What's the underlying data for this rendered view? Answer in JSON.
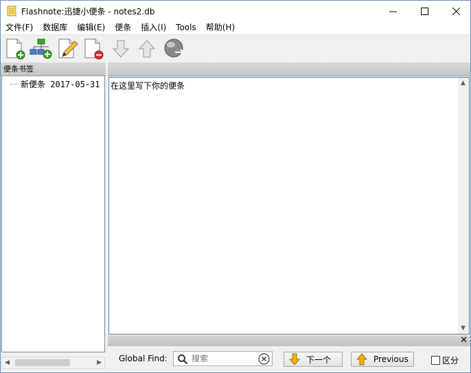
{
  "window": {
    "title": "Flashnote:迅捷小便条 - notes2.db",
    "minimize_glyph": "—",
    "maximize_glyph": "☐",
    "close_glyph": "✕"
  },
  "menu": [
    "文件(F)",
    "数据库",
    "编辑(E)",
    "便条",
    "插入(I)",
    "Tools",
    "帮助(H)"
  ],
  "toolbar": {
    "buttons": [
      "new-note-icon",
      "new-child-note-icon",
      "edit-note-icon",
      "delete-note-icon",
      "move-down-icon",
      "move-up-icon",
      "globe-icon"
    ]
  },
  "sidebar": {
    "header": "便条书签",
    "items": [
      {
        "label": "新便条 2017-05-31"
      }
    ]
  },
  "editor": {
    "content": "在这里写下你的便条"
  },
  "find": {
    "label": "Global Find:",
    "placeholder": "搜索",
    "next_label": "下一个",
    "prev_label": "Previous",
    "case_label": "区分",
    "close_glyph": "✕"
  },
  "colors": {
    "accent_border": "#3c7fb1",
    "arrow_yellow": "#f0b400"
  }
}
